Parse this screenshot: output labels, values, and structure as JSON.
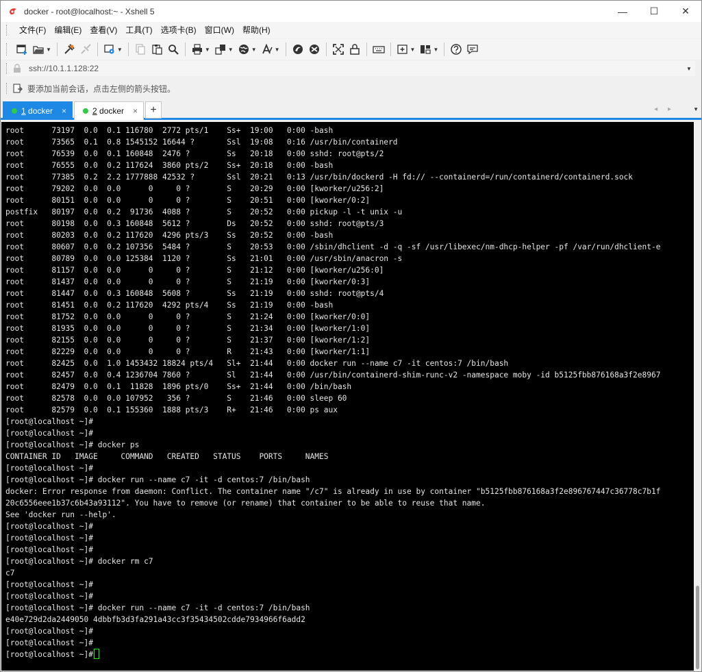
{
  "window": {
    "title": "docker - root@localhost:~ - Xshell 5",
    "min_glyph": "—",
    "max_glyph": "☐",
    "close_glyph": "✕"
  },
  "menu": {
    "items": [
      "文件(F)",
      "编辑(E)",
      "查看(V)",
      "工具(T)",
      "选项卡(B)",
      "窗口(W)",
      "帮助(H)"
    ]
  },
  "toolbar": {
    "icons": [
      "new-session-icon",
      "open-folder-icon",
      "connect-icon",
      "disconnect-icon",
      "properties-icon",
      "copy-icon",
      "paste-icon",
      "find-icon",
      "print-icon",
      "transfer-icon",
      "globe-icon",
      "font-icon",
      "xftp-icon",
      "xmanager-icon",
      "fullscreen-icon",
      "lock-icon",
      "keyboard-icon",
      "compose-icon",
      "layout-icon",
      "help-icon",
      "chat-icon"
    ]
  },
  "address": {
    "value": "ssh://10.1.1.128:22"
  },
  "hint": {
    "text": "要添加当前会话，点击左侧的箭头按钮。"
  },
  "tabs": [
    {
      "number": "1",
      "label": " docker",
      "close": "×",
      "active": true
    },
    {
      "number": "2",
      "label": " docker",
      "close": "×",
      "active": false
    }
  ],
  "tab_add": "+",
  "tab_nav": "◂ ▸",
  "tab_menu": "▼",
  "colors": {
    "accent": "#1e88e5",
    "terminal_bg": "#000000",
    "terminal_fg": "#e6e6e6",
    "cursor": "#00ff00",
    "session_dot": "#2ecc40"
  },
  "terminal": {
    "lines": [
      "root      73197  0.0  0.1 116780  2772 pts/1    Ss+  19:00   0:00 -bash",
      "root      73565  0.1  0.8 1545152 16644 ?       Ssl  19:08   0:16 /usr/bin/containerd",
      "root      76539  0.0  0.1 160848  2476 ?        Ss   20:18   0:00 sshd: root@pts/2",
      "root      76555  0.0  0.2 117624  3860 pts/2    Ss+  20:18   0:00 -bash",
      "root      77385  0.2  2.2 1777888 42532 ?       Ssl  20:21   0:13 /usr/bin/dockerd -H fd:// --containerd=/run/containerd/containerd.sock",
      "root      79202  0.0  0.0      0     0 ?        S    20:29   0:00 [kworker/u256:2]",
      "root      80151  0.0  0.0      0     0 ?        S    20:51   0:00 [kworker/0:2]",
      "postfix   80197  0.0  0.2  91736  4088 ?        S    20:52   0:00 pickup -l -t unix -u",
      "root      80198  0.0  0.3 160848  5612 ?        Ds   20:52   0:00 sshd: root@pts/3",
      "root      80203  0.0  0.2 117620  4296 pts/3    Ss   20:52   0:00 -bash",
      "root      80607  0.0  0.2 107356  5484 ?        S    20:53   0:00 /sbin/dhclient -d -q -sf /usr/libexec/nm-dhcp-helper -pf /var/run/dhclient-e",
      "root      80789  0.0  0.0 125384  1120 ?        Ss   21:01   0:00 /usr/sbin/anacron -s",
      "root      81157  0.0  0.0      0     0 ?        S    21:12   0:00 [kworker/u256:0]",
      "root      81437  0.0  0.0      0     0 ?        S    21:19   0:00 [kworker/0:3]",
      "root      81447  0.0  0.3 160848  5608 ?        Ss   21:19   0:00 sshd: root@pts/4",
      "root      81451  0.0  0.2 117620  4292 pts/4    Ss   21:19   0:00 -bash",
      "root      81752  0.0  0.0      0     0 ?        S    21:24   0:00 [kworker/0:0]",
      "root      81935  0.0  0.0      0     0 ?        S    21:34   0:00 [kworker/1:0]",
      "root      82155  0.0  0.0      0     0 ?        S    21:37   0:00 [kworker/1:2]",
      "root      82229  0.0  0.0      0     0 ?        R    21:43   0:00 [kworker/1:1]",
      "root      82425  0.0  1.0 1453432 18824 pts/4   Sl+  21:44   0:00 docker run --name c7 -it centos:7 /bin/bash",
      "root      82457  0.0  0.4 1236704 7860 ?        Sl   21:44   0:00 /usr/bin/containerd-shim-runc-v2 -namespace moby -id b5125fbb876168a3f2e8967",
      "root      82479  0.0  0.1  11828  1896 pts/0    Ss+  21:44   0:00 /bin/bash",
      "root      82578  0.0  0.0 107952   356 ?        S    21:46   0:00 sleep 60",
      "root      82579  0.0  0.1 155360  1888 pts/3    R+   21:46   0:00 ps aux",
      "[root@localhost ~]#",
      "[root@localhost ~]#",
      "[root@localhost ~]# docker ps",
      "CONTAINER ID   IMAGE     COMMAND   CREATED   STATUS    PORTS     NAMES",
      "[root@localhost ~]#",
      "[root@localhost ~]# docker run --name c7 -it -d centos:7 /bin/bash",
      "docker: Error response from daemon: Conflict. The container name \"/c7\" is already in use by container \"b5125fbb876168a3f2e896767447c36778c7b1f",
      "20c6556eee1b37c6b43a93112\". You have to remove (or rename) that container to be able to reuse that name.",
      "See 'docker run --help'.",
      "[root@localhost ~]#",
      "[root@localhost ~]#",
      "[root@localhost ~]#",
      "[root@localhost ~]# docker rm c7",
      "c7",
      "[root@localhost ~]#",
      "[root@localhost ~]#",
      "[root@localhost ~]# docker run --name c7 -it -d centos:7 /bin/bash",
      "e40e729d2da2449050 4dbbfb3d3fa291a43cc3f35434502cdde7934966f6add2",
      "[root@localhost ~]#",
      "[root@localhost ~]#",
      "[root@localhost ~]#"
    ]
  }
}
